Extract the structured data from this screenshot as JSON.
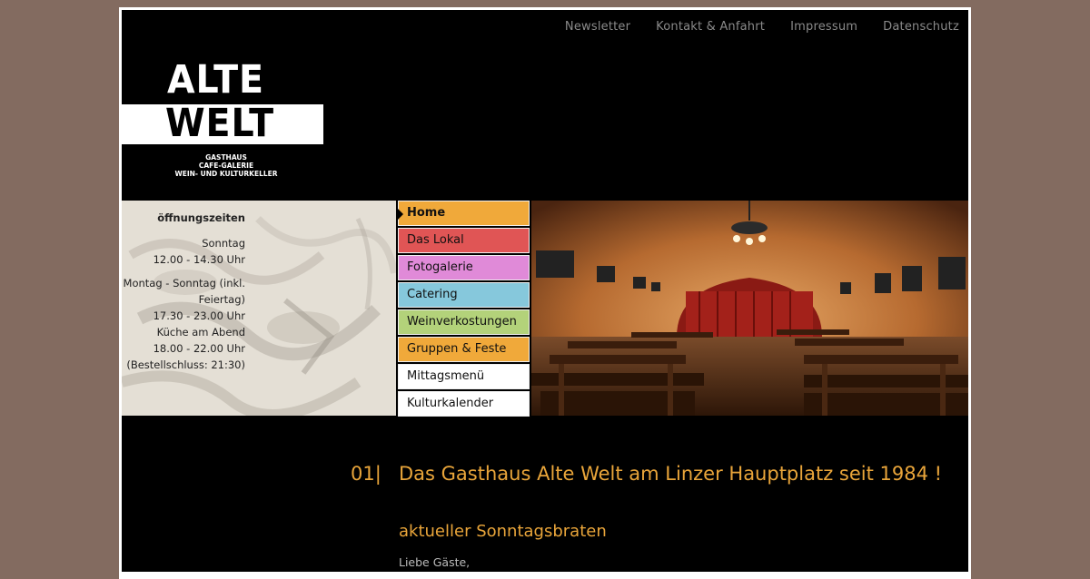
{
  "top_nav": [
    "Newsletter",
    "Kontakt & Anfahrt",
    "Impressum",
    "Datenschutz"
  ],
  "logo": {
    "line1": "ALTE",
    "line2": "WELT",
    "sub1": "GASTHAUS",
    "sub2": "CAFE-GALERIE",
    "sub3": "WEIN- UND KULTURKELLER"
  },
  "hours": {
    "heading": "öffnungszeiten",
    "l1": "Sonntag",
    "l2": "12.00 - 14.30 Uhr",
    "l3": "Montag - Sonntag (inkl. Feiertag)",
    "l4": "17.30 - 23.00 Uhr",
    "l5": "Küche am Abend",
    "l6": "18.00 - 22.00 Uhr",
    "l7": "(Bestellschluss: 21:30)"
  },
  "menu": [
    {
      "label": "Home",
      "color": "#f0a93a",
      "active": true
    },
    {
      "label": "Das Lokal",
      "color": "#e05555"
    },
    {
      "label": "Fotogalerie",
      "color": "#e08ad8"
    },
    {
      "label": "Catering",
      "color": "#86c8dc"
    },
    {
      "label": "Weinverkostungen",
      "color": "#b3d27a"
    },
    {
      "label": "Gruppen & Feste",
      "color": "#f0a93a"
    },
    {
      "label": "Mittagsmenü",
      "color": "#ffffff"
    },
    {
      "label": "Kulturkalender",
      "color": "#ffffff"
    }
  ],
  "main": {
    "number": "01|",
    "title": "Das Gasthaus Alte Welt am Linzer Hauptplatz seit 1984 !",
    "subtitle": "aktueller Sonntagsbraten",
    "greeting": "Liebe Gäste,"
  },
  "colors": {
    "accent": "#e9a53a",
    "background": "#836b60",
    "page": "#000000"
  }
}
